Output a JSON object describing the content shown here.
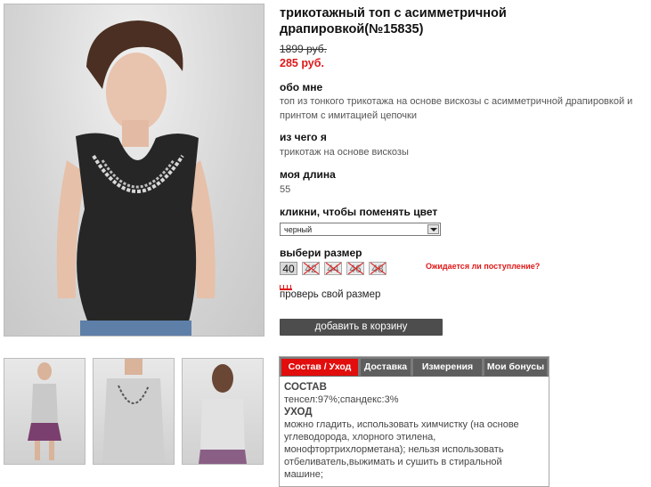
{
  "product": {
    "title": "трикотажный топ с асимметричной драпировкой(№15835)",
    "old_price": "1899 руб.",
    "new_price": "285 руб."
  },
  "about": {
    "heading": "обо мне",
    "text": "топ из тонкого трикотажа на основе вискозы с асимметричной драпировкой и принтом с имитацией цепочки"
  },
  "material": {
    "heading": "из чего я",
    "text": "трикотаж на основе вискозы"
  },
  "length": {
    "heading": "моя длина",
    "value": "55"
  },
  "color": {
    "heading": "кликни, чтобы поменять цвет",
    "selected": "черный"
  },
  "size": {
    "heading": "выбери размер",
    "options": [
      "40",
      "42",
      "44",
      "46",
      "48"
    ],
    "notify_label": "Ожидается ли поступление?",
    "check_label": "проверь свой размер"
  },
  "cart": {
    "button_label": "добавить в корзину"
  },
  "tabs": {
    "items": [
      "Состав / Уход",
      "Доставка",
      "Измерения",
      "Мои бонусы"
    ],
    "active": 0,
    "composition_heading": "СОСТАВ",
    "composition_text": "тенсел:97%;спандекс:3%",
    "care_heading": "УХОД",
    "care_text": "можно гладить, использовать химчистку (на основе углеводорода, хлорного этилена, монофтортрихлорметана); нельзя использовать отбеливатель,выжимать и сушить в стиральной машине;"
  },
  "colors": {
    "accent": "#e01818",
    "button": "#4d4d4d",
    "tab_bar": "#7b7b7b"
  },
  "icons": {
    "dropdown": "chevron-down-icon",
    "ruler": "ruler-icon"
  }
}
